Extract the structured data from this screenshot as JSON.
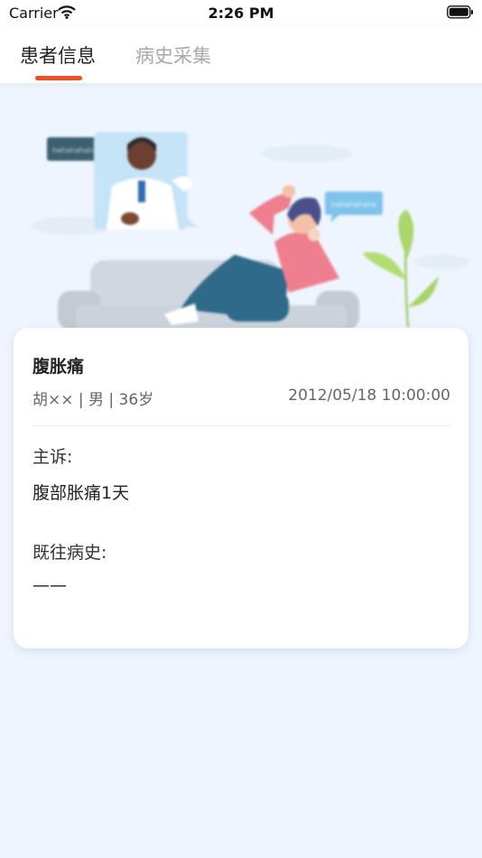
{
  "status_bar": {
    "carrier": "Carrier",
    "time": "2:26 PM",
    "wifi_icon": "wifi-icon",
    "battery_icon": "battery-icon"
  },
  "tabs": [
    {
      "label": "患者信息",
      "active": true
    },
    {
      "label": "病史采集",
      "active": false
    }
  ],
  "colors": {
    "accent": "#f24e23",
    "background": "#eef5fe"
  },
  "illustration": {
    "bubble_text_left": "hahahahaha",
    "bubble_text_right": "hahahahaha"
  },
  "record": {
    "diagnosis": "腹胀痛",
    "patient_info": "胡×× | 男 | 36岁",
    "visit_time": "2012/05/18 10:00:00",
    "complaint_label": "主诉:",
    "complaint_value": "腹部胀痛1天",
    "history_label": "既往病史:",
    "history_value": "——"
  }
}
